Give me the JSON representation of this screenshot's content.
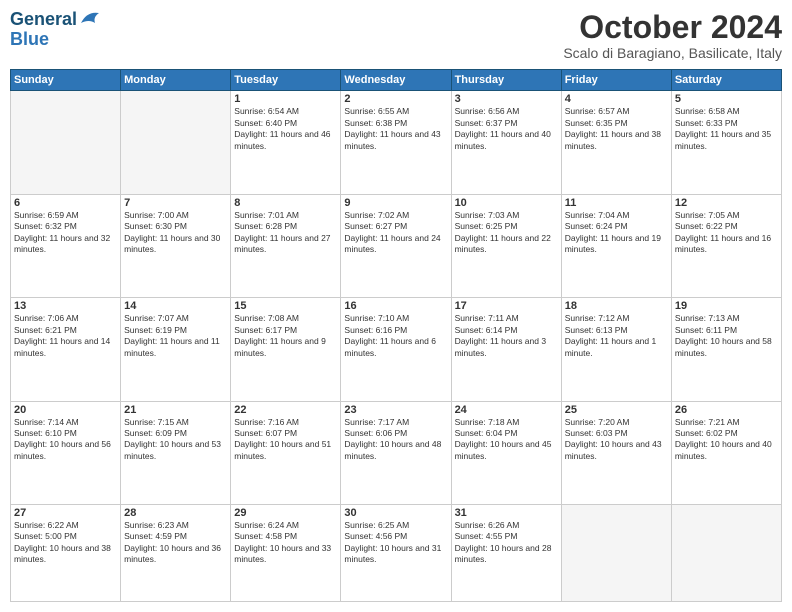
{
  "logo": {
    "line1": "General",
    "line2": "Blue"
  },
  "title": "October 2024",
  "subtitle": "Scalo di Baragiano, Basilicate, Italy",
  "days_header": [
    "Sunday",
    "Monday",
    "Tuesday",
    "Wednesday",
    "Thursday",
    "Friday",
    "Saturday"
  ],
  "weeks": [
    [
      {
        "day": "",
        "info": ""
      },
      {
        "day": "",
        "info": ""
      },
      {
        "day": "1",
        "info": "Sunrise: 6:54 AM\nSunset: 6:40 PM\nDaylight: 11 hours and 46 minutes."
      },
      {
        "day": "2",
        "info": "Sunrise: 6:55 AM\nSunset: 6:38 PM\nDaylight: 11 hours and 43 minutes."
      },
      {
        "day": "3",
        "info": "Sunrise: 6:56 AM\nSunset: 6:37 PM\nDaylight: 11 hours and 40 minutes."
      },
      {
        "day": "4",
        "info": "Sunrise: 6:57 AM\nSunset: 6:35 PM\nDaylight: 11 hours and 38 minutes."
      },
      {
        "day": "5",
        "info": "Sunrise: 6:58 AM\nSunset: 6:33 PM\nDaylight: 11 hours and 35 minutes."
      }
    ],
    [
      {
        "day": "6",
        "info": "Sunrise: 6:59 AM\nSunset: 6:32 PM\nDaylight: 11 hours and 32 minutes."
      },
      {
        "day": "7",
        "info": "Sunrise: 7:00 AM\nSunset: 6:30 PM\nDaylight: 11 hours and 30 minutes."
      },
      {
        "day": "8",
        "info": "Sunrise: 7:01 AM\nSunset: 6:28 PM\nDaylight: 11 hours and 27 minutes."
      },
      {
        "day": "9",
        "info": "Sunrise: 7:02 AM\nSunset: 6:27 PM\nDaylight: 11 hours and 24 minutes."
      },
      {
        "day": "10",
        "info": "Sunrise: 7:03 AM\nSunset: 6:25 PM\nDaylight: 11 hours and 22 minutes."
      },
      {
        "day": "11",
        "info": "Sunrise: 7:04 AM\nSunset: 6:24 PM\nDaylight: 11 hours and 19 minutes."
      },
      {
        "day": "12",
        "info": "Sunrise: 7:05 AM\nSunset: 6:22 PM\nDaylight: 11 hours and 16 minutes."
      }
    ],
    [
      {
        "day": "13",
        "info": "Sunrise: 7:06 AM\nSunset: 6:21 PM\nDaylight: 11 hours and 14 minutes."
      },
      {
        "day": "14",
        "info": "Sunrise: 7:07 AM\nSunset: 6:19 PM\nDaylight: 11 hours and 11 minutes."
      },
      {
        "day": "15",
        "info": "Sunrise: 7:08 AM\nSunset: 6:17 PM\nDaylight: 11 hours and 9 minutes."
      },
      {
        "day": "16",
        "info": "Sunrise: 7:10 AM\nSunset: 6:16 PM\nDaylight: 11 hours and 6 minutes."
      },
      {
        "day": "17",
        "info": "Sunrise: 7:11 AM\nSunset: 6:14 PM\nDaylight: 11 hours and 3 minutes."
      },
      {
        "day": "18",
        "info": "Sunrise: 7:12 AM\nSunset: 6:13 PM\nDaylight: 11 hours and 1 minute."
      },
      {
        "day": "19",
        "info": "Sunrise: 7:13 AM\nSunset: 6:11 PM\nDaylight: 10 hours and 58 minutes."
      }
    ],
    [
      {
        "day": "20",
        "info": "Sunrise: 7:14 AM\nSunset: 6:10 PM\nDaylight: 10 hours and 56 minutes."
      },
      {
        "day": "21",
        "info": "Sunrise: 7:15 AM\nSunset: 6:09 PM\nDaylight: 10 hours and 53 minutes."
      },
      {
        "day": "22",
        "info": "Sunrise: 7:16 AM\nSunset: 6:07 PM\nDaylight: 10 hours and 51 minutes."
      },
      {
        "day": "23",
        "info": "Sunrise: 7:17 AM\nSunset: 6:06 PM\nDaylight: 10 hours and 48 minutes."
      },
      {
        "day": "24",
        "info": "Sunrise: 7:18 AM\nSunset: 6:04 PM\nDaylight: 10 hours and 45 minutes."
      },
      {
        "day": "25",
        "info": "Sunrise: 7:20 AM\nSunset: 6:03 PM\nDaylight: 10 hours and 43 minutes."
      },
      {
        "day": "26",
        "info": "Sunrise: 7:21 AM\nSunset: 6:02 PM\nDaylight: 10 hours and 40 minutes."
      }
    ],
    [
      {
        "day": "27",
        "info": "Sunrise: 6:22 AM\nSunset: 5:00 PM\nDaylight: 10 hours and 38 minutes."
      },
      {
        "day": "28",
        "info": "Sunrise: 6:23 AM\nSunset: 4:59 PM\nDaylight: 10 hours and 36 minutes."
      },
      {
        "day": "29",
        "info": "Sunrise: 6:24 AM\nSunset: 4:58 PM\nDaylight: 10 hours and 33 minutes."
      },
      {
        "day": "30",
        "info": "Sunrise: 6:25 AM\nSunset: 4:56 PM\nDaylight: 10 hours and 31 minutes."
      },
      {
        "day": "31",
        "info": "Sunrise: 6:26 AM\nSunset: 4:55 PM\nDaylight: 10 hours and 28 minutes."
      },
      {
        "day": "",
        "info": ""
      },
      {
        "day": "",
        "info": ""
      }
    ]
  ]
}
